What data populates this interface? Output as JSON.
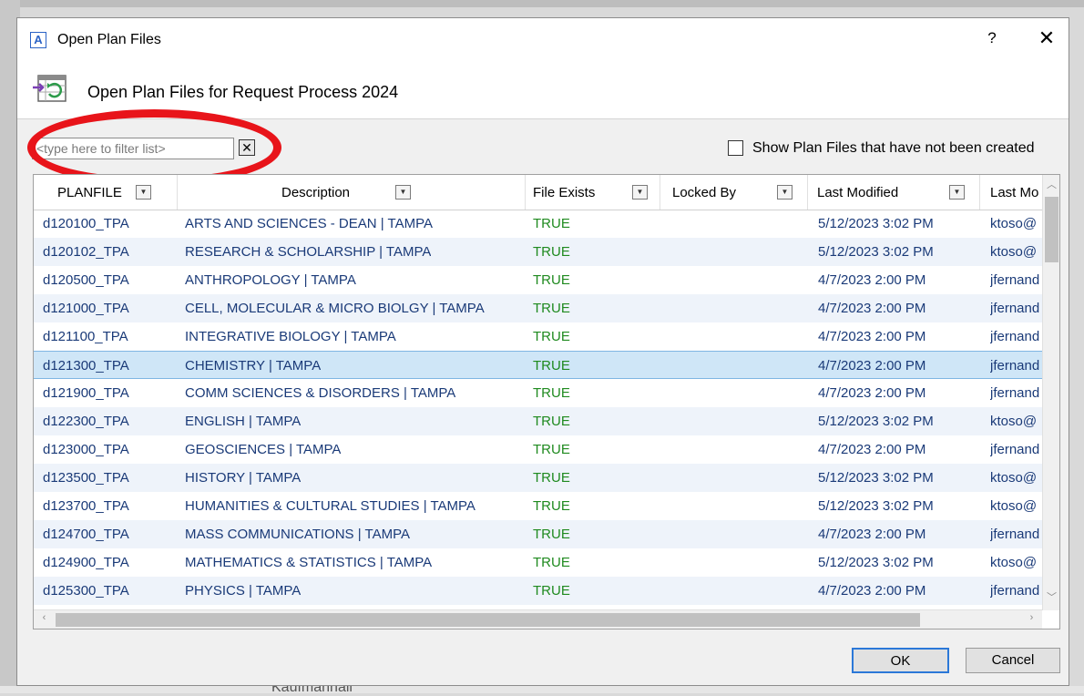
{
  "background": {
    "partial_text": "Kaufmannall"
  },
  "window": {
    "title": "Open Plan Files",
    "app_icon_letter": "A",
    "help_label": "?",
    "close_label": "✕"
  },
  "header": {
    "title": "Open Plan Files for Request Process 2024"
  },
  "filter": {
    "placeholder": "<type here to filter list>",
    "value": "",
    "clear_label": "✕"
  },
  "show_uncreated": {
    "label": "Show Plan Files that have not been created",
    "checked": false
  },
  "table": {
    "columns": [
      "PLANFILE",
      "Description",
      "File Exists",
      "Locked By",
      "Last Modified",
      "Last Mo"
    ],
    "rows": [
      [
        "d120100_TPA",
        "ARTS AND SCIENCES - DEAN | TAMPA",
        "TRUE",
        "",
        "5/12/2023 3:02 PM",
        "ktoso@"
      ],
      [
        "d120102_TPA",
        "RESEARCH & SCHOLARSHIP | TAMPA",
        "TRUE",
        "",
        "5/12/2023 3:02 PM",
        "ktoso@"
      ],
      [
        "d120500_TPA",
        "ANTHROPOLOGY | TAMPA",
        "TRUE",
        "",
        "4/7/2023 2:00 PM",
        "jfernand"
      ],
      [
        "d121000_TPA",
        "CELL, MOLECULAR & MICRO BIOLGY | TAMPA",
        "TRUE",
        "",
        "4/7/2023 2:00 PM",
        "jfernand"
      ],
      [
        "d121100_TPA",
        "INTEGRATIVE BIOLOGY | TAMPA",
        "TRUE",
        "",
        "4/7/2023 2:00 PM",
        "jfernand"
      ],
      [
        "d121300_TPA",
        "CHEMISTRY | TAMPA",
        "TRUE",
        "",
        "4/7/2023 2:00 PM",
        "jfernand"
      ],
      [
        "d121900_TPA",
        "COMM SCIENCES & DISORDERS | TAMPA",
        "TRUE",
        "",
        "4/7/2023 2:00 PM",
        "jfernand"
      ],
      [
        "d122300_TPA",
        "ENGLISH | TAMPA",
        "TRUE",
        "",
        "5/12/2023 3:02 PM",
        "ktoso@"
      ],
      [
        "d123000_TPA",
        "GEOSCIENCES | TAMPA",
        "TRUE",
        "",
        "4/7/2023 2:00 PM",
        "jfernand"
      ],
      [
        "d123500_TPA",
        "HISTORY | TAMPA",
        "TRUE",
        "",
        "5/12/2023 3:02 PM",
        "ktoso@"
      ],
      [
        "d123700_TPA",
        "HUMANITIES & CULTURAL STUDIES | TAMPA",
        "TRUE",
        "",
        "5/12/2023 3:02 PM",
        "ktoso@"
      ],
      [
        "d124700_TPA",
        "MASS COMMUNICATIONS | TAMPA",
        "TRUE",
        "",
        "4/7/2023 2:00 PM",
        "jfernand"
      ],
      [
        "d124900_TPA",
        "MATHEMATICS & STATISTICS | TAMPA",
        "TRUE",
        "",
        "5/12/2023 3:02 PM",
        "ktoso@"
      ],
      [
        "d125300_TPA",
        "PHYSICS | TAMPA",
        "TRUE",
        "",
        "4/7/2023 2:00 PM",
        "jfernand"
      ]
    ],
    "selected_row": "d121300_TPA",
    "colors": {
      "true_value": "#1f8a1f",
      "text": "#1a3a78",
      "selection": "#cfe6f7",
      "annotation": "#e8141a"
    }
  },
  "buttons": {
    "ok": "OK",
    "cancel": "Cancel"
  }
}
